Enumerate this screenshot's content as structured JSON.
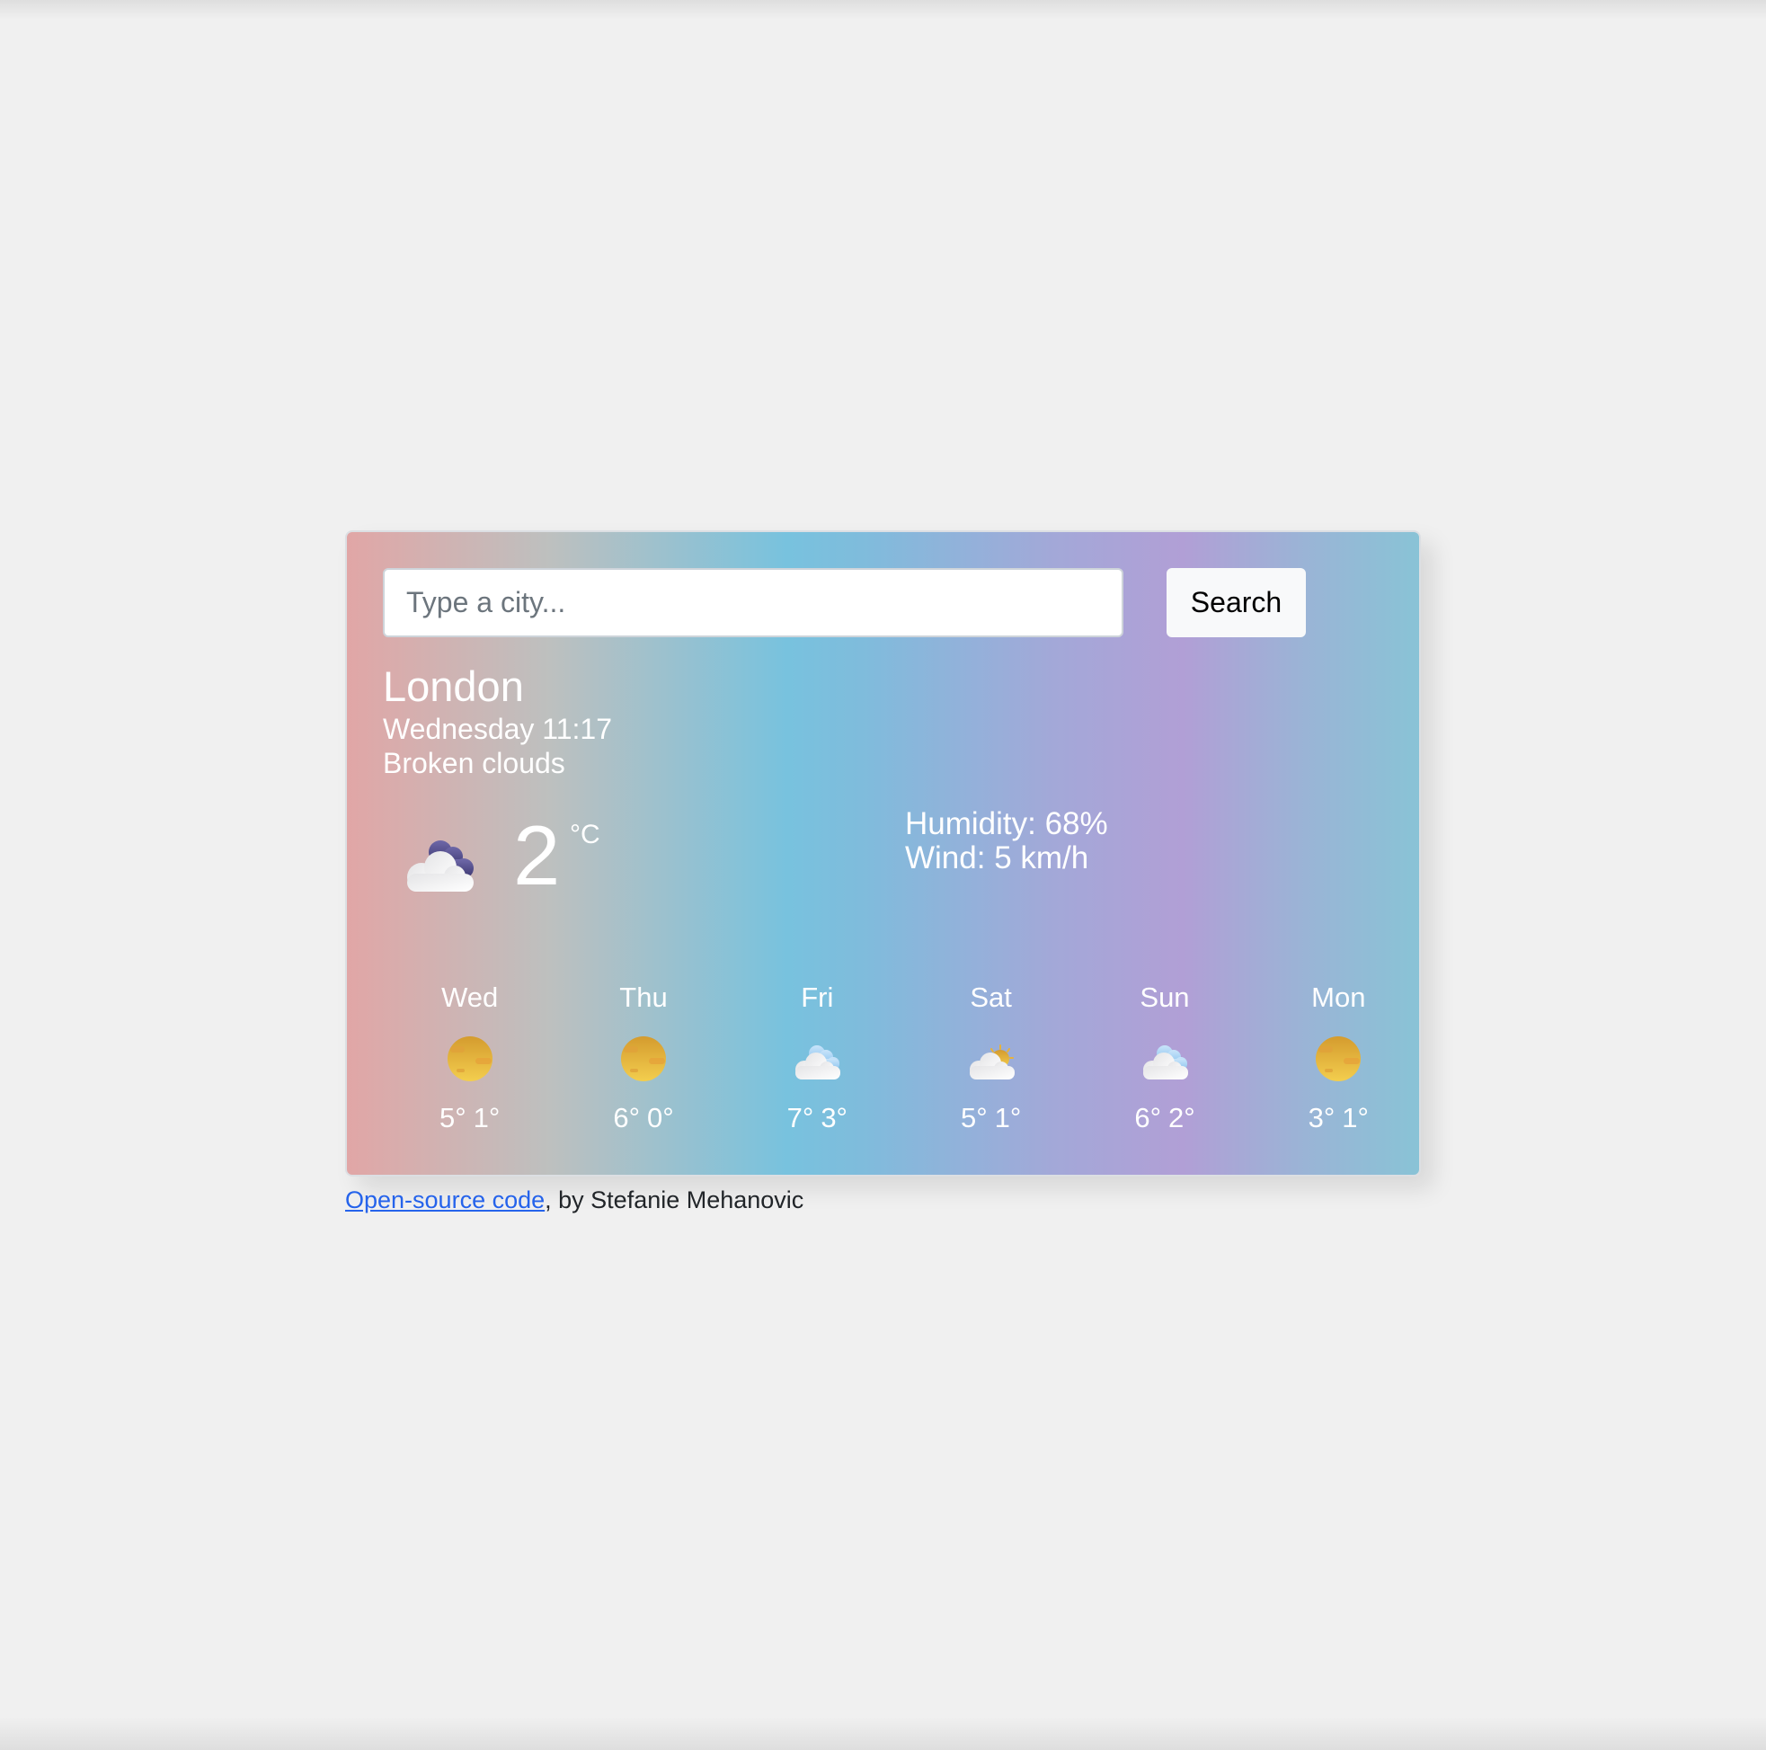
{
  "search": {
    "placeholder": "Type a city...",
    "value": "",
    "button_label": "Search"
  },
  "current": {
    "city": "London",
    "datetime": "Wednesday 11:17",
    "description": "Broken clouds",
    "icon": "broken-clouds-icon",
    "temperature": "2",
    "unit": "°C",
    "humidity": "Humidity: 68%",
    "wind": "Wind: 5 km/h"
  },
  "forecast": [
    {
      "day": "Wed",
      "icon": "clear-sky-icon",
      "max": "5°",
      "min": "1°"
    },
    {
      "day": "Thu",
      "icon": "clear-sky-icon",
      "max": "6°",
      "min": "0°"
    },
    {
      "day": "Fri",
      "icon": "scattered-clouds-icon",
      "max": "7°",
      "min": "3°"
    },
    {
      "day": "Sat",
      "icon": "few-clouds-icon",
      "max": "5°",
      "min": "1°"
    },
    {
      "day": "Sun",
      "icon": "scattered-clouds-icon",
      "max": "6°",
      "min": "2°"
    },
    {
      "day": "Mon",
      "icon": "clear-sky-icon",
      "max": "3°",
      "min": "1°"
    }
  ],
  "footer": {
    "link_text": "Open-source code",
    "suffix": ", by Stefanie Mehanovic"
  },
  "colors": {
    "gradient": [
      "#e1a6a6",
      "#bdc0bf",
      "#78c2de",
      "#b19fd6",
      "#89c3d6"
    ],
    "link": "#2563eb",
    "text_on_card": "#ffffff"
  }
}
